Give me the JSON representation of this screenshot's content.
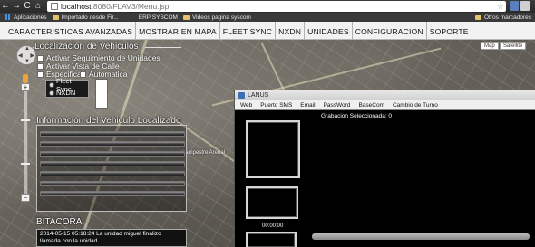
{
  "browser": {
    "url_host": "localhost",
    "url_path": ":8080/FLAV3/Menu.jsp",
    "nav_back": "←",
    "nav_forward": "→",
    "nav_reload": "C",
    "nav_home": "⌂",
    "bookmarks": [
      "Aplicaciones",
      "Importado desde Fir...",
      "ERP SYSCOM",
      "Videos pagina syscom"
    ],
    "bookmarks_right": "Otros marcadores"
  },
  "menu": {
    "items": [
      "CARACTERISTICAS AVANZADAS",
      "MOSTRAR EN MAPA",
      "FLEET SYNC",
      "NXDN",
      "UNIDADES",
      "CONFIGURACION",
      "SOPORTE"
    ]
  },
  "map": {
    "type_map": "Map",
    "type_satellite": "Satellite",
    "labels": [
      "Campestre Arenal"
    ]
  },
  "localizacion": {
    "title": "Localizacion de Vehiculos",
    "opt_seguimiento": "Activar Seguimiento de Unidades",
    "opt_vista_calle": "Activar Vista de Calle",
    "opt_especifica": "Especifica",
    "opt_automatica": "Automatica",
    "radio_fleet": "Fleet Sync",
    "radio_nxdn": "NXDN"
  },
  "informacion": {
    "title": "Informacion del Vehiculo Localizado"
  },
  "bitacora": {
    "title": "BITACORA",
    "entry": "2014-05-15 05:18:24 La unidad miguel finalizo llamada con la unidad"
  },
  "lanus": {
    "title": "LANUS",
    "menu": [
      "Web",
      "Puerto SMS",
      "Email",
      "PassWord",
      "BaseCom",
      "Cambio de Turno"
    ],
    "grabacion": "Grabacion Seleccionada: 0",
    "time": "00:00:00"
  }
}
